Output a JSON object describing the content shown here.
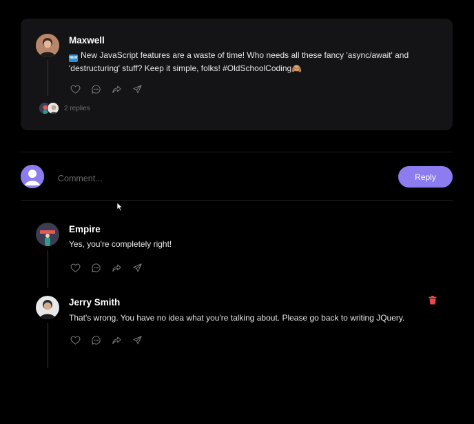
{
  "post": {
    "author": "Maxwell",
    "badge": "NEW",
    "text_line1": "New JavaScript features are a waste of time! Who needs all these fancy 'async/await' and",
    "text_line2": "'destructuring' stuff? Keep it simple, folks! #OldSchoolCoding",
    "emoji": "🙈",
    "replies_label": "2 replies"
  },
  "composer": {
    "placeholder": "Comment...",
    "reply_label": "Reply"
  },
  "comments": [
    {
      "author": "Empire",
      "text": "Yes, you're completely right!"
    },
    {
      "author": "Jerry Smith",
      "text": "That's wrong. You have no idea what you're talking about. Please go back to writing JQuery."
    }
  ],
  "colors": {
    "card_bg": "#141416",
    "accent": "#8b7cf0",
    "danger": "#e5484d",
    "icon": "#7c7c82"
  },
  "icons": [
    "heart-icon",
    "comment-icon",
    "share-icon",
    "send-icon",
    "trash-icon",
    "user-icon"
  ]
}
